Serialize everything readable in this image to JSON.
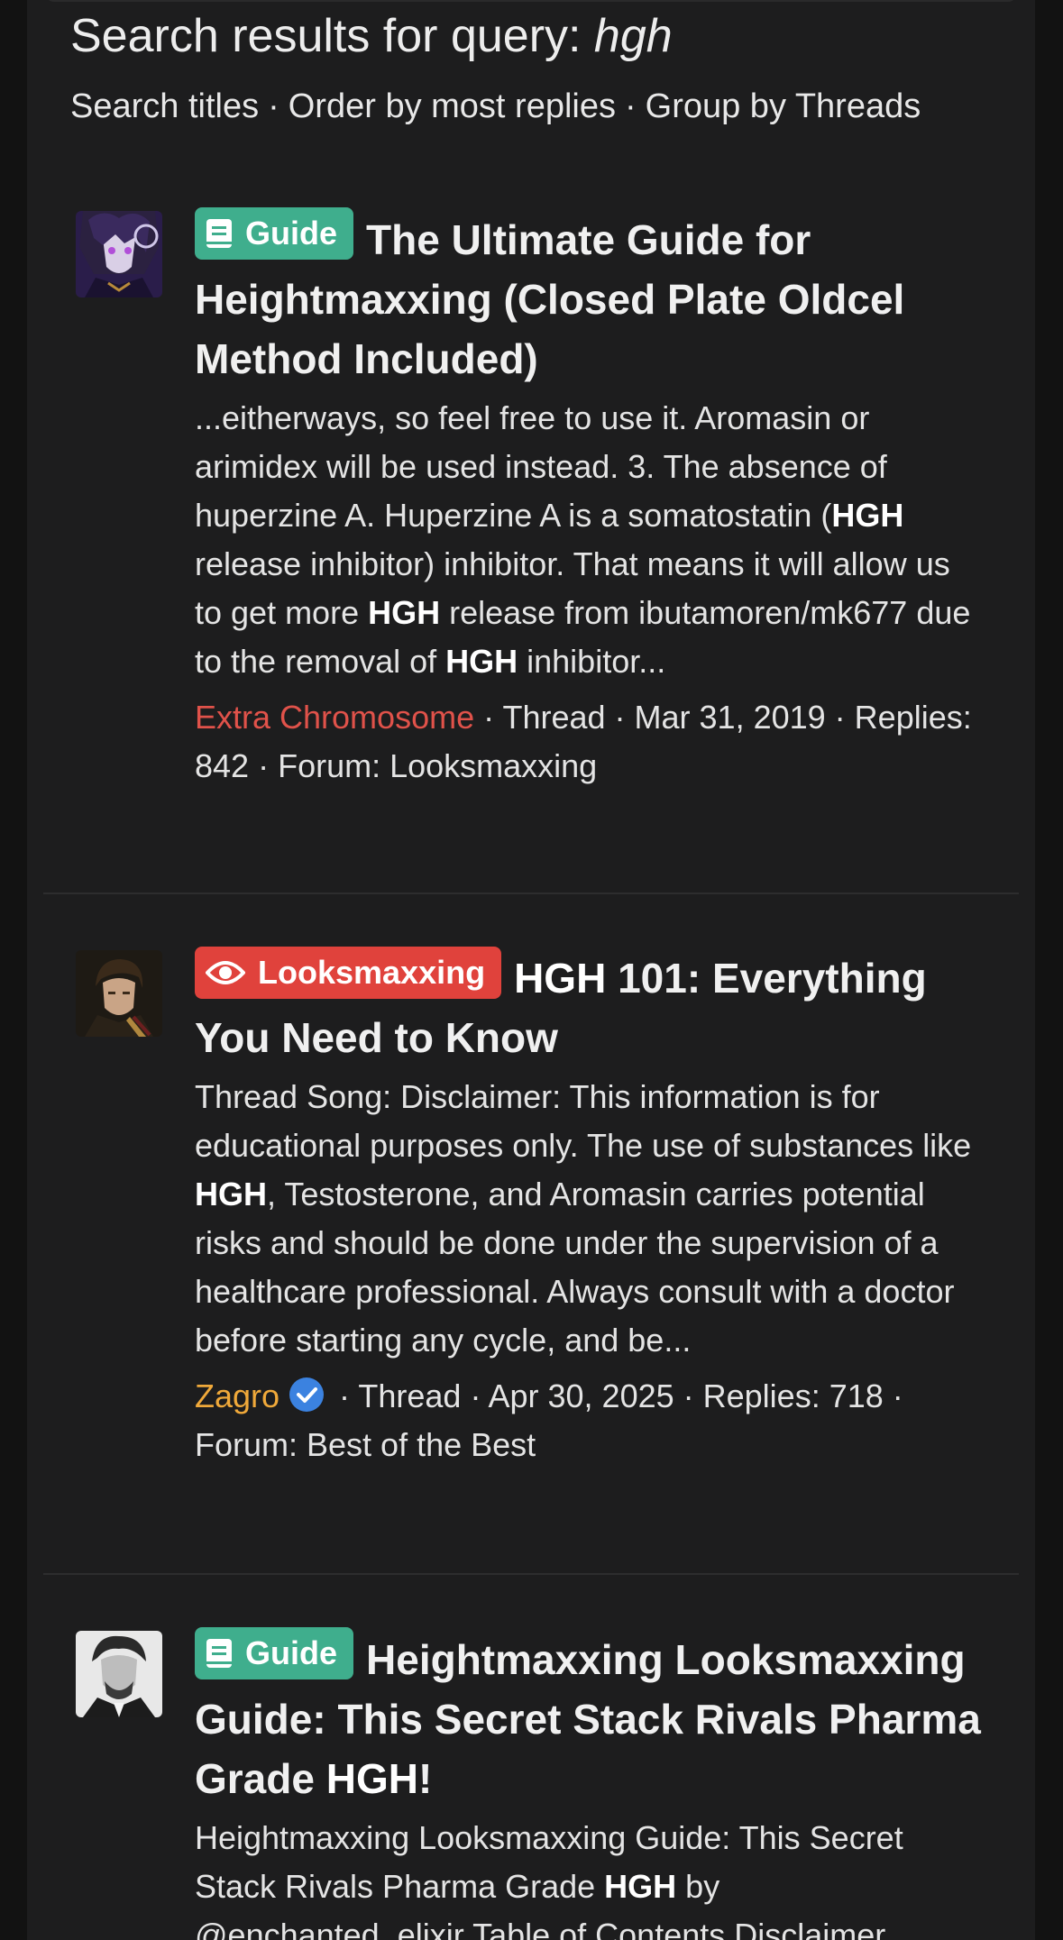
{
  "header": {
    "title_prefix": "Search results for query:",
    "query": "hgh",
    "options": [
      "Search titles",
      "Order by most replies",
      "Group by Threads"
    ],
    "separator": "·"
  },
  "results": [
    {
      "badge": {
        "label": "Guide",
        "icon": "book-icon",
        "color": "#3fae8d"
      },
      "title": "The Ultimate Guide for Heightmaxxing (Closed Plate Oldcel Method Included)",
      "snippet_parts": [
        "...eitherways, so feel free to use it. Aromasin or arimidex will be used instead. 3. The absence of huperzine A. Huperzine A is a somatostatin (",
        "HGH",
        " release inhibitor) inhibitor. That means it will allow us to get more ",
        "HGH",
        " release from ibutamoren/mk677 due to the removal of ",
        "HGH",
        " inhibitor..."
      ],
      "author": "Extra Chromosome",
      "author_color": "#e0524a",
      "type": "Thread",
      "date": "Mar 31, 2019",
      "replies": "Replies: 842",
      "forum": "Forum: Looksmaxxing"
    },
    {
      "badge": {
        "label": "Looksmaxxing",
        "icon": "eye-icon",
        "color": "#e0423c"
      },
      "title_bold": "HGH",
      "title": " 101: Everything You Need to Know",
      "snippet_parts": [
        "Thread Song: Disclaimer: This information is for educational purposes only. The use of substances like ",
        "HGH",
        ", Testosterone, and Aromasin carries potential risks and should be done under the supervision of a healthcare professional. Always consult with a doctor before starting any cycle, and be..."
      ],
      "author": "Zagro",
      "author_color": "#f0a93a",
      "verified_icon": "verified-check-icon",
      "type": "Thread",
      "date": "Apr 30, 2025",
      "replies": "Replies: 718",
      "forum": "Forum: Best of the Best"
    },
    {
      "badge": {
        "label": "Guide",
        "icon": "book-icon",
        "color": "#3fae8d"
      },
      "title": "Heightmaxxing Looksmaxxing Guide: This Secret Stack Rivals Pharma Grade ",
      "title_bold": "HGH",
      "title_suffix": "!",
      "snippet_parts": [
        "Heightmaxxing Looksmaxxing Guide: This Secret Stack Rivals Pharma Grade ",
        "HGH",
        " by @enchanted_elixir Table of Contents Disclaimer"
      ]
    }
  ]
}
